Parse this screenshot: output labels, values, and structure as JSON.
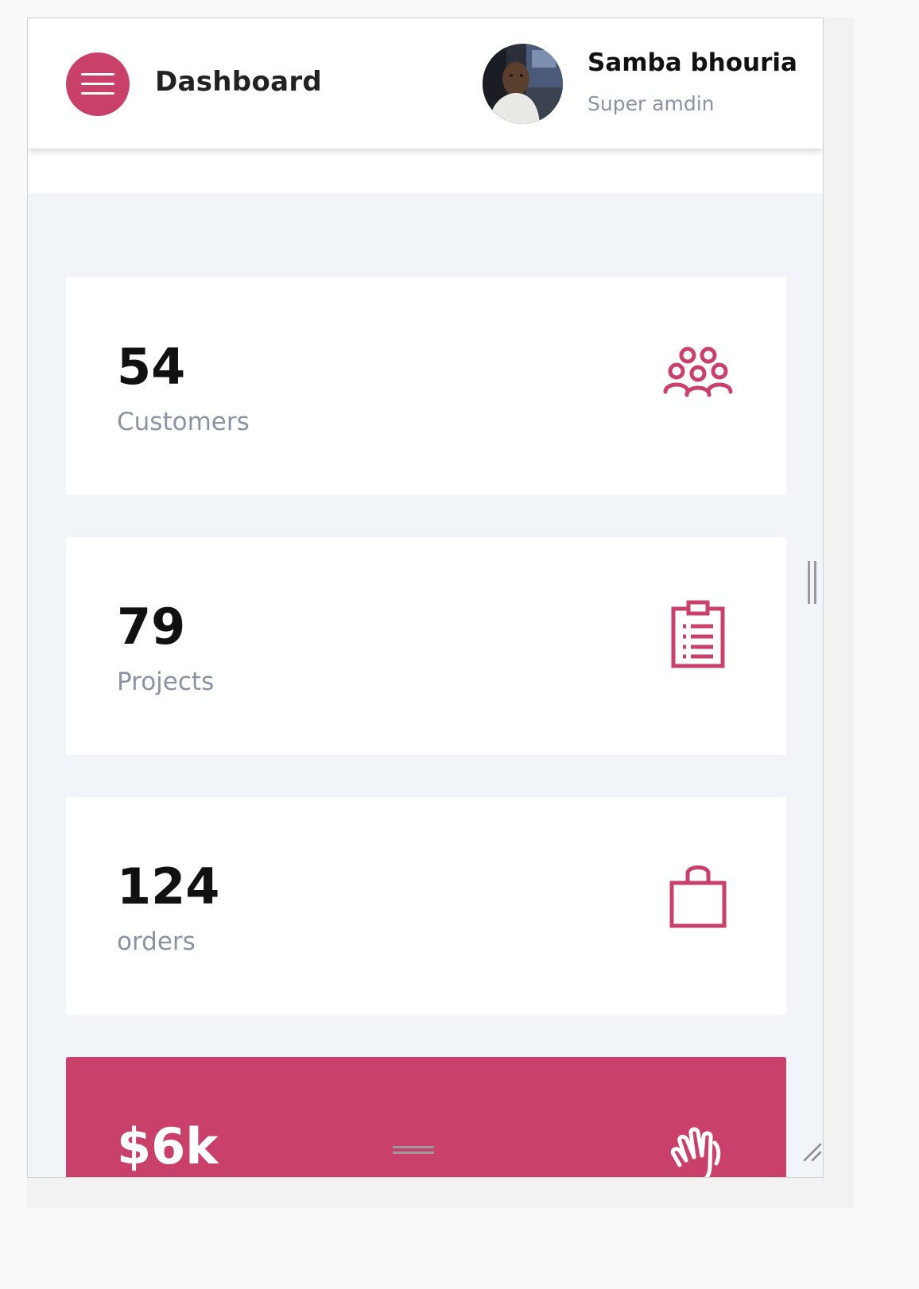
{
  "header": {
    "title": "Dashboard",
    "menu_icon": "hamburger-menu-icon",
    "user": {
      "name": "Samba bhouria",
      "role": "Super amdin"
    }
  },
  "cards": [
    {
      "value": "54",
      "label": "Customers",
      "icon": "users-group-icon"
    },
    {
      "value": "79",
      "label": "Projects",
      "icon": "clipboard-list-icon"
    },
    {
      "value": "124",
      "label": "orders",
      "icon": "shopping-bag-icon"
    },
    {
      "value": "$6k",
      "label": "",
      "icon": "hand-wave-icon"
    }
  ],
  "colors": {
    "accent": "#c9406b",
    "background": "#f1f4f9",
    "muted_text": "#8a93a3"
  }
}
